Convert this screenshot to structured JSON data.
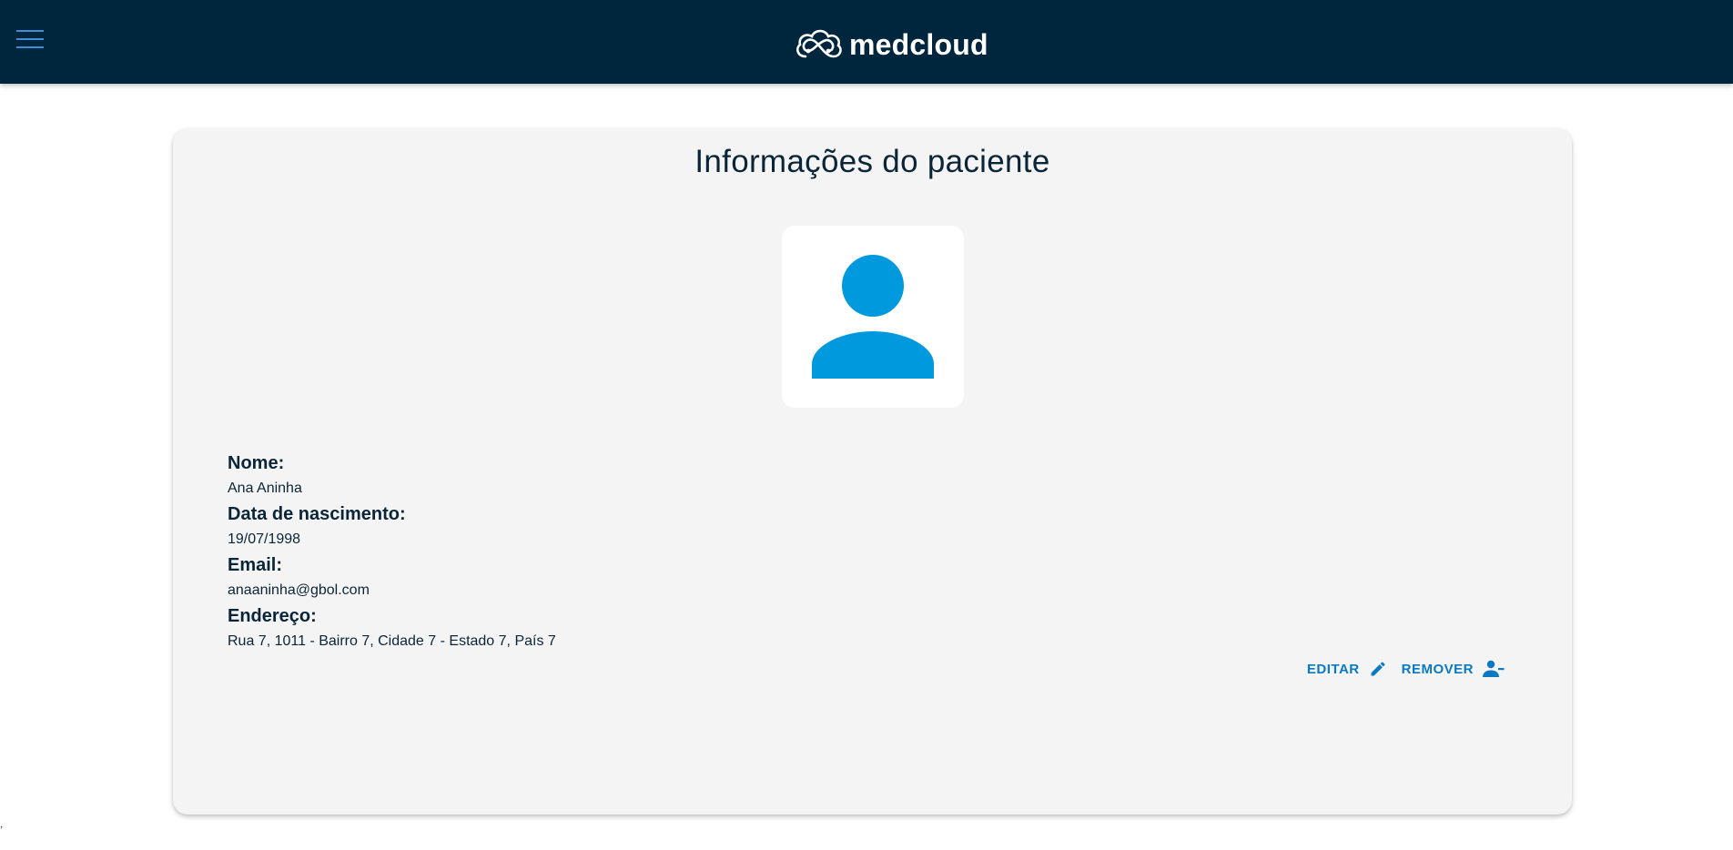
{
  "header": {
    "menu_icon": "menu-icon",
    "logo_icon": "medcloud-logo-icon",
    "logo_text": "medcloud",
    "background_color": "#00263d"
  },
  "patient": {
    "title": "Informações do paciente",
    "avatar_icon": "person-icon",
    "fields": [
      {
        "label": "Nome:",
        "value": "Ana Aninha"
      },
      {
        "label": "Data de nascimento:",
        "value": "19/07/1998"
      },
      {
        "label": "Email:",
        "value": "anaaninha@gbol.com"
      },
      {
        "label": "Endereço:",
        "value": "Rua 7, 1011 - Bairro 7, Cidade 7 - Estado 7, País 7"
      }
    ],
    "actions": {
      "edit_label": "EDITAR",
      "edit_icon": "pencil-icon",
      "remove_label": "REMOVER",
      "remove_icon": "person-remove-icon"
    }
  },
  "colors": {
    "accent": "#0a79c4",
    "avatar": "#0099dd",
    "text": "#0b2538",
    "card": "#f4f4f4"
  },
  "stray_text": ","
}
